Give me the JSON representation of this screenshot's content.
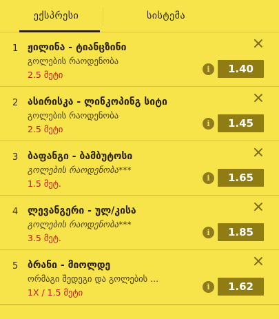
{
  "tabs": [
    {
      "label": "ექსპრესი",
      "active": true
    },
    {
      "label": "სისტემა",
      "active": false
    }
  ],
  "bets": [
    {
      "num": "1",
      "teams": "ჟილინა - ტიანცზინი",
      "market": "გოლების რაოდენობა",
      "pick": "2.5 მეტი",
      "odd": "1.40"
    },
    {
      "num": "2",
      "teams": "ასირისკა - ლინკოპინგ სიტი",
      "market": "გოლების რაოდენობა",
      "pick": "2.5 მეტი",
      "odd": "1.45"
    },
    {
      "num": "3",
      "teams": "ბაფანგი - ბამბუტოსი",
      "market": "გოლების რაოდენობა***",
      "pick": "1.5 მეტ.",
      "odd": "1.65"
    },
    {
      "num": "4",
      "teams": "ლევანგერი - ულ/კისა",
      "market": "გოლების რაოდენობა***",
      "pick": "3.5 მეტ.",
      "odd": "1.85"
    },
    {
      "num": "5",
      "teams": "ბრანი - მიოლდე",
      "market": "ორმაგი შედეგი და გოლების ...",
      "pick": "1X / 1.5 მეტი",
      "odd": "1.62"
    }
  ],
  "info_glyph": "i",
  "colors": {
    "background": "#f7e34a",
    "odd_button": "#8f7c12",
    "pick_text": "#c4161c"
  }
}
